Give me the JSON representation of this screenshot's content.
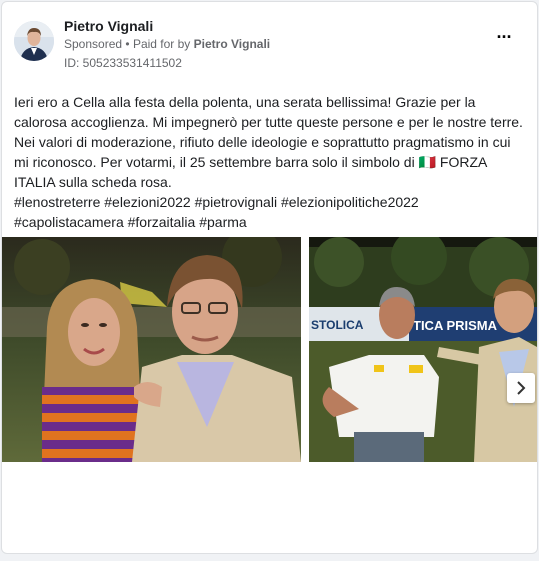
{
  "post": {
    "author": "Pietro Vignali",
    "sponsored_label": "Sponsored",
    "separator": "•",
    "paid_for_prefix": "Paid for by",
    "paid_for_name": "Pietro Vignali",
    "ad_id": "ID: 505233531411502",
    "more_icon": "more-dots-icon",
    "text_lines": [
      "Ieri ero a Cella alla festa della polenta, una serata bellissima! Grazie per la calorosa accoglienza. Mi impegnerò per tutte queste persone e per le nostre terre.",
      "Nei valori di moderazione, rifiuto delle ideologie e soprattutto pragmatismo in cui mi riconosco. Per votarmi, il 25 settembre barra solo il simbolo di 🇮🇹 FORZA ITALIA sulla scheda rosa.",
      "#lenostreterre #elezioni2022 #pietrovignali #elezionipolitiche2022 #capolistacamera #forzaitalia #parma"
    ]
  },
  "photos": {
    "banner_text_left": "STOLICA",
    "banner_text_right": "TICA PRISMA",
    "next_icon": "chevron-right-icon"
  },
  "colors": {
    "card_bg": "#ffffff",
    "page_bg": "#f0f2f5",
    "secondary_text": "#65676b"
  }
}
